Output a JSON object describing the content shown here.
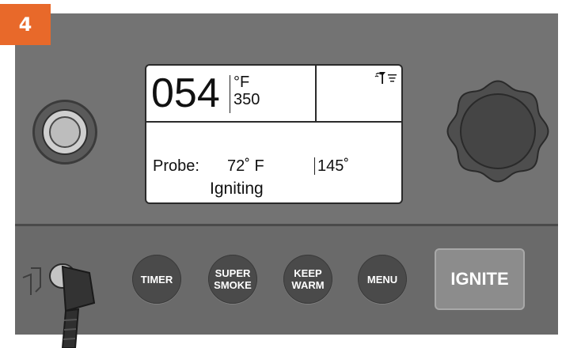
{
  "step_badge": "4",
  "display": {
    "current_temp": "054",
    "temp_unit": "°F",
    "set_temp": "350",
    "probe_label": "Probe:",
    "probe_temp": "72˚ F",
    "probe_target": "145˚",
    "status": "Igniting",
    "status_icons": [
      "wifi-signal-icon",
      "menu-lines-icon"
    ]
  },
  "buttons": {
    "timer": "TIMER",
    "super_smoke_line1": "SUPER",
    "super_smoke_line2": "SMOKE",
    "keep_warm_line1": "KEEP",
    "keep_warm_line2": "WARM",
    "menu": "MENU",
    "ignite": "IGNITE"
  },
  "colors": {
    "badge": "#e8692a",
    "panel": "#737373",
    "button": "#4a4a4a",
    "ignite": "#8c8c8c"
  }
}
